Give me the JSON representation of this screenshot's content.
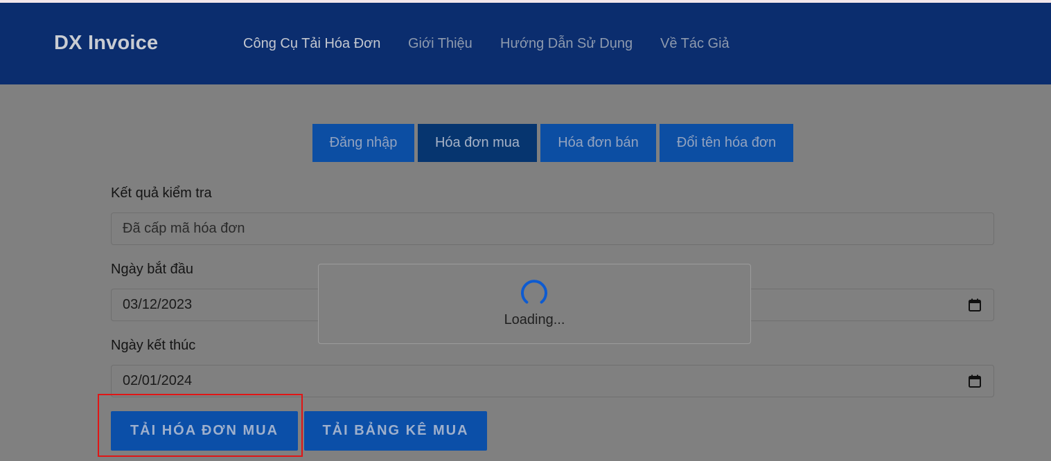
{
  "header": {
    "brand": "DX Invoice",
    "nav": [
      {
        "label": "Công Cụ Tải Hóa Đơn",
        "active": true
      },
      {
        "label": "Giới Thiệu"
      },
      {
        "label": "Hướng Dẫn Sử Dụng"
      },
      {
        "label": "Về Tác Giả"
      }
    ]
  },
  "tabs": [
    {
      "label": "Đăng nhập"
    },
    {
      "label": "Hóa đơn mua",
      "active": true
    },
    {
      "label": "Hóa đơn bán"
    },
    {
      "label": "Đổi tên hóa đơn"
    }
  ],
  "form": {
    "check_result": {
      "label": "Kết quả kiểm tra",
      "value": "Đã cấp mã hóa đơn"
    },
    "start_date": {
      "label": "Ngày bắt đầu",
      "value": "03/12/2023",
      "icon": "calendar-icon"
    },
    "end_date": {
      "label": "Ngày kết thúc",
      "value": "02/01/2024",
      "icon": "calendar-icon"
    }
  },
  "buttons": {
    "download_invoices": "TẢI HÓA ĐƠN MUA",
    "download_list": "TẢI BẢNG KÊ MUA"
  },
  "loading": {
    "text": "Loading...",
    "icon": "spinner-icon"
  },
  "colors": {
    "navbar": "#0b2d6e",
    "accent": "#0c4ea3",
    "active_tab": "#06356f",
    "overlay": "#808080",
    "highlight": "#e01515",
    "spinner": "#0d5bd1"
  }
}
